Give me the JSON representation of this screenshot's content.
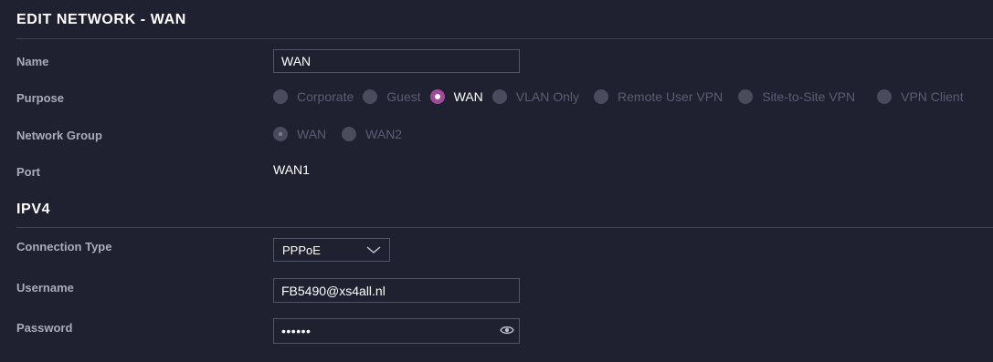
{
  "header": {
    "title": "EDIT NETWORK - WAN"
  },
  "form": {
    "name": {
      "label": "Name",
      "value": "WAN"
    },
    "purpose": {
      "label": "Purpose",
      "options": [
        "Corporate",
        "Guest",
        "WAN",
        "VLAN Only",
        "Remote User VPN",
        "Site-to-Site VPN",
        "VPN Client"
      ],
      "selected": "WAN"
    },
    "network_group": {
      "label": "Network Group",
      "options": [
        "WAN",
        "WAN2"
      ],
      "selected": "WAN"
    },
    "port": {
      "label": "Port",
      "value": "WAN1"
    }
  },
  "ipv4": {
    "title": "IPV4",
    "connection_type": {
      "label": "Connection Type",
      "value": "PPPoE",
      "icon": "chevron-down-icon"
    },
    "username": {
      "label": "Username",
      "value": "FB5490@xs4all.nl"
    },
    "password": {
      "label": "Password",
      "masked_value": "••••••",
      "icon": "eye-icon"
    }
  },
  "colors": {
    "accent": "#a04a98",
    "background": "#1f2030"
  }
}
